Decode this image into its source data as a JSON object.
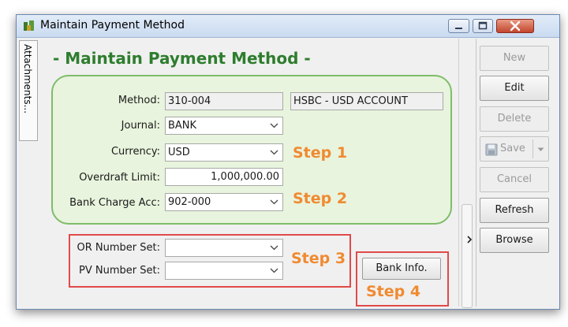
{
  "window": {
    "title": "Maintain Payment Method"
  },
  "side_tab": {
    "label": "Attachments..."
  },
  "heading": "- Maintain Payment Method -",
  "form": {
    "method": {
      "label": "Method:",
      "value": "310-004",
      "description": "HSBC - USD ACCOUNT"
    },
    "journal": {
      "label": "Journal:",
      "value": "BANK"
    },
    "currency": {
      "label": "Currency:",
      "value": "USD"
    },
    "overdraft_limit": {
      "label": "Overdraft Limit:",
      "value": "1,000,000.00"
    },
    "bank_charge_acc": {
      "label": "Bank Charge Acc:",
      "value": "902-000"
    },
    "or_number_set": {
      "label": "OR Number Set:",
      "value": ""
    },
    "pv_number_set": {
      "label": "PV Number Set:",
      "value": ""
    },
    "bank_info_button": "Bank Info."
  },
  "annotations": {
    "step1": "Step 1",
    "step2": "Step 2",
    "step3": "Step 3",
    "step4": "Step 4"
  },
  "toolbar": {
    "new": "New",
    "edit": "Edit",
    "delete": "Delete",
    "save": "Save",
    "cancel": "Cancel",
    "refresh": "Refresh",
    "browse": "Browse"
  },
  "colors": {
    "heading_green": "#2e7d2e",
    "panel_fill": "#e8f4dd",
    "panel_border": "#7fbc6a",
    "step_orange": "#f08a30",
    "highlight_red": "#e04a4a"
  },
  "icons": [
    "app-icon",
    "minimize-icon",
    "maximize-icon",
    "close-icon",
    "chevron-down-icon",
    "floppy-disk-icon",
    "chevron-right-icon"
  ]
}
